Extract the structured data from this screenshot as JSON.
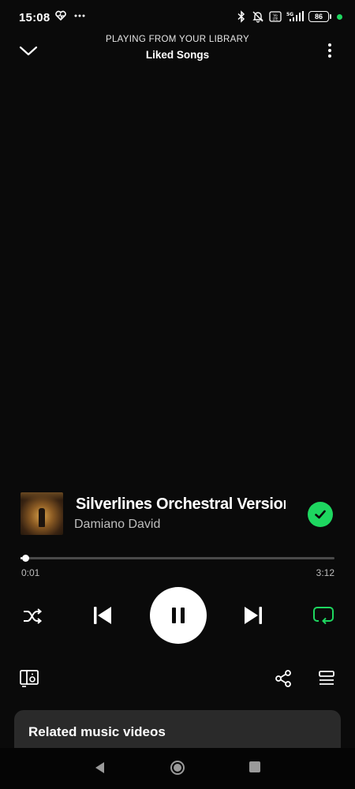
{
  "status_bar": {
    "time": "15:08",
    "battery": "86",
    "icons": [
      "heart-rate-icon",
      "more-dots-icon",
      "bluetooth-icon",
      "mute-bell-icon",
      "volte-icon",
      "5g-signal-icon",
      "battery-icon",
      "green-dot"
    ]
  },
  "header": {
    "subtitle": "PLAYING FROM YOUR LIBRARY",
    "title": "Liked Songs"
  },
  "track": {
    "title": "Silverlines Orchestral Version",
    "artist": "Damiano David",
    "liked": true
  },
  "progress": {
    "elapsed": "0:01",
    "total": "3:12",
    "fraction": 0.005
  },
  "controls": {
    "shuffle_on": false,
    "playing": true,
    "repeat_on": true
  },
  "related": {
    "title": "Related music videos"
  },
  "colors": {
    "background": "#0a0a0a",
    "accent": "#1ed760",
    "card": "#2a2a2a",
    "text_secondary": "#bdbdbd"
  }
}
